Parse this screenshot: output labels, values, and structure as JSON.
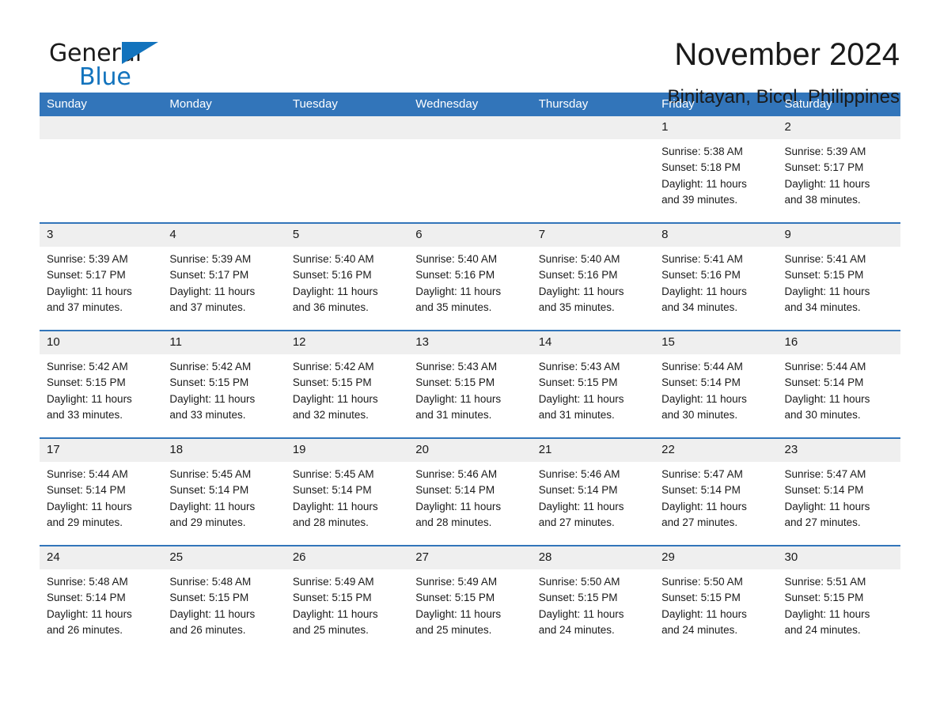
{
  "brand": {
    "name_part1": "General",
    "name_part2": "Blue",
    "logo_icon": "triangle-logo-icon"
  },
  "header": {
    "month_title": "November 2024",
    "location": "Binitayan, Bicol, Philippines"
  },
  "colors": {
    "header_blue": "#3275ba",
    "brand_blue": "#1273bd",
    "daynum_gray": "#efefef",
    "text": "#1a1a1a"
  },
  "weekday_headers": [
    "Sunday",
    "Monday",
    "Tuesday",
    "Wednesday",
    "Thursday",
    "Friday",
    "Saturday"
  ],
  "weeks": [
    [
      {
        "day": "",
        "sunrise": "",
        "sunset": "",
        "daylight1": "",
        "daylight2": ""
      },
      {
        "day": "",
        "sunrise": "",
        "sunset": "",
        "daylight1": "",
        "daylight2": ""
      },
      {
        "day": "",
        "sunrise": "",
        "sunset": "",
        "daylight1": "",
        "daylight2": ""
      },
      {
        "day": "",
        "sunrise": "",
        "sunset": "",
        "daylight1": "",
        "daylight2": ""
      },
      {
        "day": "",
        "sunrise": "",
        "sunset": "",
        "daylight1": "",
        "daylight2": ""
      },
      {
        "day": "1",
        "sunrise": "Sunrise: 5:38 AM",
        "sunset": "Sunset: 5:18 PM",
        "daylight1": "Daylight: 11 hours",
        "daylight2": "and 39 minutes."
      },
      {
        "day": "2",
        "sunrise": "Sunrise: 5:39 AM",
        "sunset": "Sunset: 5:17 PM",
        "daylight1": "Daylight: 11 hours",
        "daylight2": "and 38 minutes."
      }
    ],
    [
      {
        "day": "3",
        "sunrise": "Sunrise: 5:39 AM",
        "sunset": "Sunset: 5:17 PM",
        "daylight1": "Daylight: 11 hours",
        "daylight2": "and 37 minutes."
      },
      {
        "day": "4",
        "sunrise": "Sunrise: 5:39 AM",
        "sunset": "Sunset: 5:17 PM",
        "daylight1": "Daylight: 11 hours",
        "daylight2": "and 37 minutes."
      },
      {
        "day": "5",
        "sunrise": "Sunrise: 5:40 AM",
        "sunset": "Sunset: 5:16 PM",
        "daylight1": "Daylight: 11 hours",
        "daylight2": "and 36 minutes."
      },
      {
        "day": "6",
        "sunrise": "Sunrise: 5:40 AM",
        "sunset": "Sunset: 5:16 PM",
        "daylight1": "Daylight: 11 hours",
        "daylight2": "and 35 minutes."
      },
      {
        "day": "7",
        "sunrise": "Sunrise: 5:40 AM",
        "sunset": "Sunset: 5:16 PM",
        "daylight1": "Daylight: 11 hours",
        "daylight2": "and 35 minutes."
      },
      {
        "day": "8",
        "sunrise": "Sunrise: 5:41 AM",
        "sunset": "Sunset: 5:16 PM",
        "daylight1": "Daylight: 11 hours",
        "daylight2": "and 34 minutes."
      },
      {
        "day": "9",
        "sunrise": "Sunrise: 5:41 AM",
        "sunset": "Sunset: 5:15 PM",
        "daylight1": "Daylight: 11 hours",
        "daylight2": "and 34 minutes."
      }
    ],
    [
      {
        "day": "10",
        "sunrise": "Sunrise: 5:42 AM",
        "sunset": "Sunset: 5:15 PM",
        "daylight1": "Daylight: 11 hours",
        "daylight2": "and 33 minutes."
      },
      {
        "day": "11",
        "sunrise": "Sunrise: 5:42 AM",
        "sunset": "Sunset: 5:15 PM",
        "daylight1": "Daylight: 11 hours",
        "daylight2": "and 33 minutes."
      },
      {
        "day": "12",
        "sunrise": "Sunrise: 5:42 AM",
        "sunset": "Sunset: 5:15 PM",
        "daylight1": "Daylight: 11 hours",
        "daylight2": "and 32 minutes."
      },
      {
        "day": "13",
        "sunrise": "Sunrise: 5:43 AM",
        "sunset": "Sunset: 5:15 PM",
        "daylight1": "Daylight: 11 hours",
        "daylight2": "and 31 minutes."
      },
      {
        "day": "14",
        "sunrise": "Sunrise: 5:43 AM",
        "sunset": "Sunset: 5:15 PM",
        "daylight1": "Daylight: 11 hours",
        "daylight2": "and 31 minutes."
      },
      {
        "day": "15",
        "sunrise": "Sunrise: 5:44 AM",
        "sunset": "Sunset: 5:14 PM",
        "daylight1": "Daylight: 11 hours",
        "daylight2": "and 30 minutes."
      },
      {
        "day": "16",
        "sunrise": "Sunrise: 5:44 AM",
        "sunset": "Sunset: 5:14 PM",
        "daylight1": "Daylight: 11 hours",
        "daylight2": "and 30 minutes."
      }
    ],
    [
      {
        "day": "17",
        "sunrise": "Sunrise: 5:44 AM",
        "sunset": "Sunset: 5:14 PM",
        "daylight1": "Daylight: 11 hours",
        "daylight2": "and 29 minutes."
      },
      {
        "day": "18",
        "sunrise": "Sunrise: 5:45 AM",
        "sunset": "Sunset: 5:14 PM",
        "daylight1": "Daylight: 11 hours",
        "daylight2": "and 29 minutes."
      },
      {
        "day": "19",
        "sunrise": "Sunrise: 5:45 AM",
        "sunset": "Sunset: 5:14 PM",
        "daylight1": "Daylight: 11 hours",
        "daylight2": "and 28 minutes."
      },
      {
        "day": "20",
        "sunrise": "Sunrise: 5:46 AM",
        "sunset": "Sunset: 5:14 PM",
        "daylight1": "Daylight: 11 hours",
        "daylight2": "and 28 minutes."
      },
      {
        "day": "21",
        "sunrise": "Sunrise: 5:46 AM",
        "sunset": "Sunset: 5:14 PM",
        "daylight1": "Daylight: 11 hours",
        "daylight2": "and 27 minutes."
      },
      {
        "day": "22",
        "sunrise": "Sunrise: 5:47 AM",
        "sunset": "Sunset: 5:14 PM",
        "daylight1": "Daylight: 11 hours",
        "daylight2": "and 27 minutes."
      },
      {
        "day": "23",
        "sunrise": "Sunrise: 5:47 AM",
        "sunset": "Sunset: 5:14 PM",
        "daylight1": "Daylight: 11 hours",
        "daylight2": "and 27 minutes."
      }
    ],
    [
      {
        "day": "24",
        "sunrise": "Sunrise: 5:48 AM",
        "sunset": "Sunset: 5:14 PM",
        "daylight1": "Daylight: 11 hours",
        "daylight2": "and 26 minutes."
      },
      {
        "day": "25",
        "sunrise": "Sunrise: 5:48 AM",
        "sunset": "Sunset: 5:15 PM",
        "daylight1": "Daylight: 11 hours",
        "daylight2": "and 26 minutes."
      },
      {
        "day": "26",
        "sunrise": "Sunrise: 5:49 AM",
        "sunset": "Sunset: 5:15 PM",
        "daylight1": "Daylight: 11 hours",
        "daylight2": "and 25 minutes."
      },
      {
        "day": "27",
        "sunrise": "Sunrise: 5:49 AM",
        "sunset": "Sunset: 5:15 PM",
        "daylight1": "Daylight: 11 hours",
        "daylight2": "and 25 minutes."
      },
      {
        "day": "28",
        "sunrise": "Sunrise: 5:50 AM",
        "sunset": "Sunset: 5:15 PM",
        "daylight1": "Daylight: 11 hours",
        "daylight2": "and 24 minutes."
      },
      {
        "day": "29",
        "sunrise": "Sunrise: 5:50 AM",
        "sunset": "Sunset: 5:15 PM",
        "daylight1": "Daylight: 11 hours",
        "daylight2": "and 24 minutes."
      },
      {
        "day": "30",
        "sunrise": "Sunrise: 5:51 AM",
        "sunset": "Sunset: 5:15 PM",
        "daylight1": "Daylight: 11 hours",
        "daylight2": "and 24 minutes."
      }
    ]
  ]
}
